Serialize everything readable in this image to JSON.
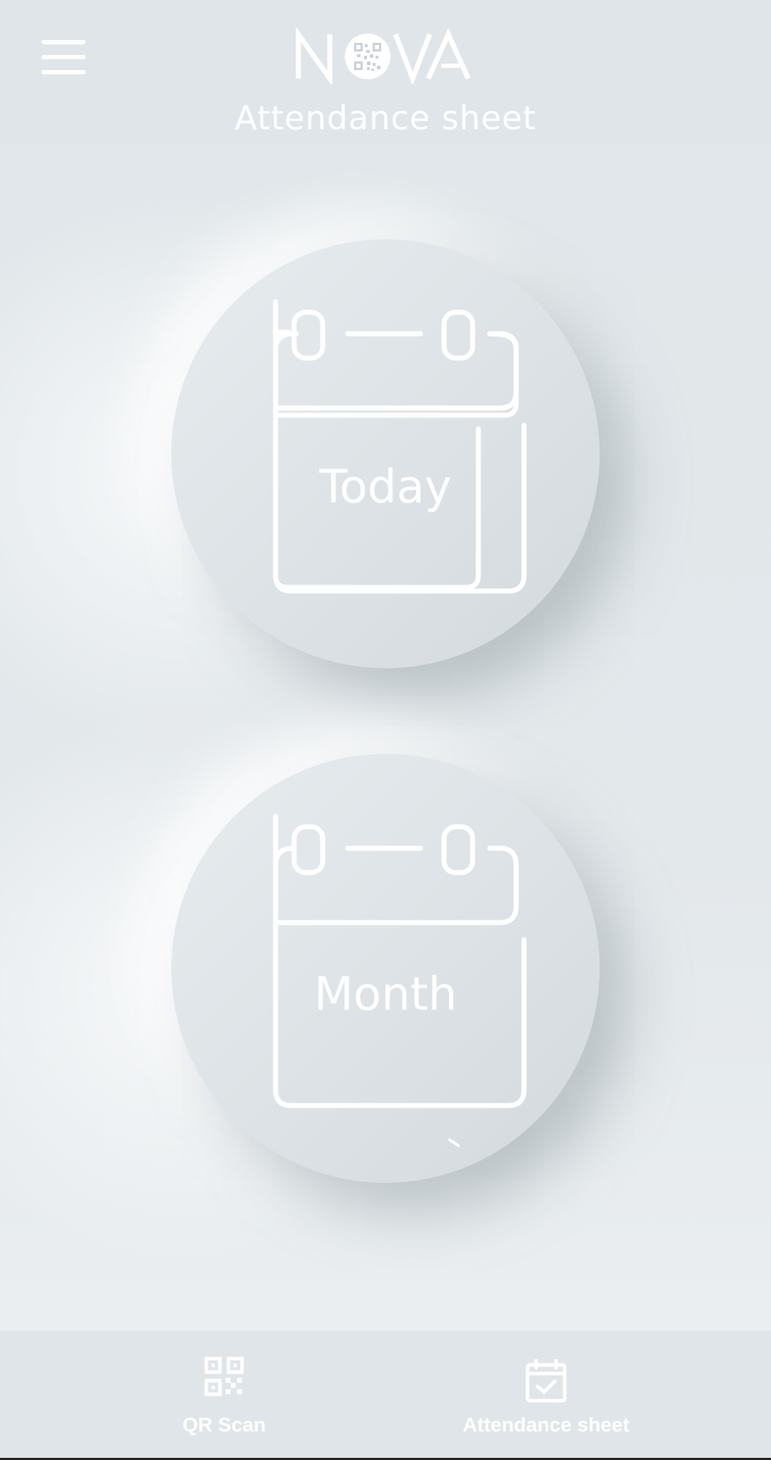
{
  "header": {
    "menu_icon": "hamburger-menu-icon",
    "logo_text": "NOVA",
    "title": "Attendance sheet"
  },
  "main": {
    "buttons": [
      {
        "label": "Today",
        "icon": "calendar-icon"
      },
      {
        "label": "Month",
        "icon": "calendar-icon"
      }
    ]
  },
  "bottom_nav": {
    "items": [
      {
        "label": "QR Scan",
        "icon": "qr-code-icon"
      },
      {
        "label": "Attendance sheet",
        "icon": "calendar-check-icon"
      }
    ]
  },
  "colors": {
    "background": "#dfe5e8",
    "foreground": "#ffffff"
  }
}
